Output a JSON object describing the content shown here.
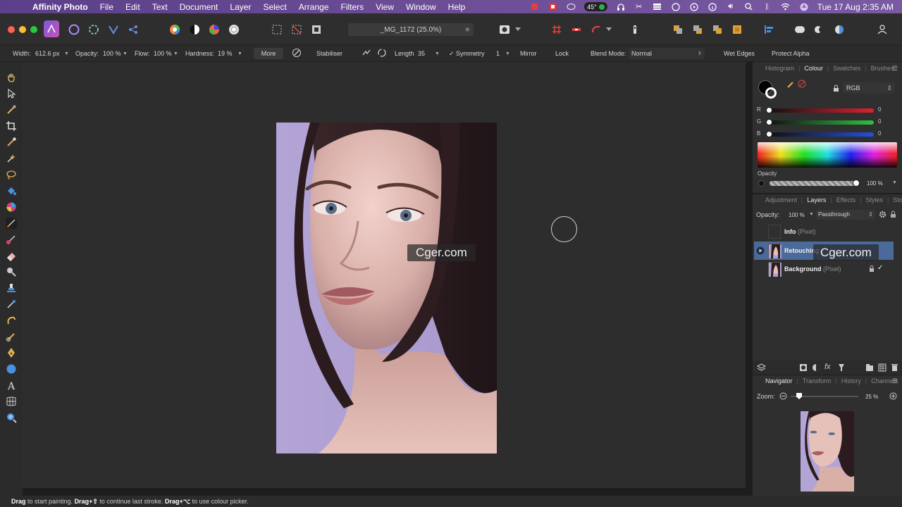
{
  "menubar": {
    "app_name": "Affinity Photo",
    "items": [
      "File",
      "Edit",
      "Text",
      "Document",
      "Layer",
      "Select",
      "Arrange",
      "Filters",
      "View",
      "Window",
      "Help"
    ],
    "temperature": "45°",
    "datetime": "Tue 17 Aug  2:35 AM"
  },
  "toolbar": {
    "document_title": "_MG_1172 (25.0%)"
  },
  "context_toolbar": {
    "width_label": "Width:",
    "width_value": "612.6 px",
    "opacity_label": "Opacity:",
    "opacity_value": "100 %",
    "flow_label": "Flow:",
    "flow_value": "100 %",
    "hardness_label": "Hardness:",
    "hardness_value": "19 %",
    "more_label": "More",
    "stabiliser_label": "Stabiliser",
    "length_label": "Length",
    "length_value": "35",
    "symmetry_label": "✓ Symmetry",
    "symmetry_value": "1",
    "mirror_label": "Mirror",
    "lock_label": "Lock",
    "blend_mode_label": "Blend Mode:",
    "blend_mode_value": "Normal",
    "wet_edges_label": "Wet Edges",
    "protect_alpha_label": "Protect Alpha"
  },
  "colour_panel": {
    "tabs": [
      "Histogram",
      "Colour",
      "Swatches",
      "Brushes"
    ],
    "active_tab": "Colour",
    "model": "RGB",
    "r_label": "R",
    "r_value": "0",
    "g_label": "G",
    "g_value": "0",
    "b_label": "B",
    "b_value": "0",
    "opacity_label": "Opacity",
    "opacity_value": "100 %"
  },
  "layers_panel": {
    "tabs": [
      "Adjustment",
      "Layers",
      "Effects",
      "Styles",
      "Stock"
    ],
    "active_tab": "Layers",
    "opacity_label": "Opacity:",
    "opacity_value": "100 %",
    "blend_value": "Passthrough",
    "layers": [
      {
        "name": "Info",
        "kind": "(Pixel)"
      },
      {
        "name": "Retouching",
        "kind": ""
      },
      {
        "name": "Background",
        "kind": "(Pixel)"
      }
    ]
  },
  "navigator_panel": {
    "tabs": [
      "Navigator",
      "Transform",
      "History",
      "Channels"
    ],
    "active_tab": "Navigator",
    "zoom_label": "Zoom:",
    "zoom_value": "25 %"
  },
  "watermarks": {
    "canvas": "Cger.com",
    "panel": "Cger.com"
  },
  "status_bar": {
    "part1_bold": "Drag",
    "part1": " to start painting. ",
    "part2_bold": "Drag+⇧",
    "part2": " to continue last stroke. ",
    "part3_bold": "Drag+⌥",
    "part3": " to use colour picker."
  },
  "colors": {
    "canvas_bg": "#2d2d2d",
    "panel_bg": "#2f2f2f",
    "menubar_purple": "#6b4c95",
    "selected_layer": "#4a6a9a"
  }
}
